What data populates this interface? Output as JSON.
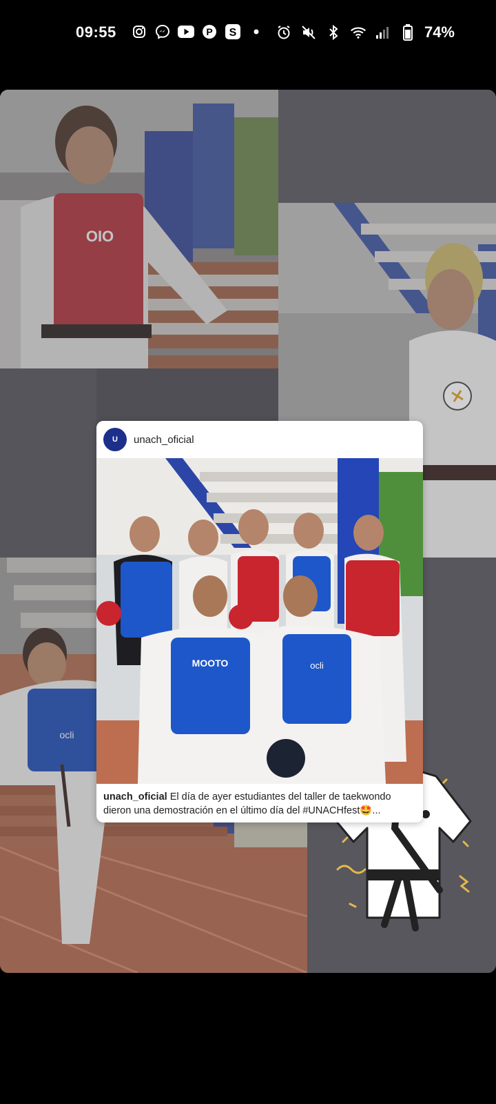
{
  "status_bar": {
    "time": "09:55",
    "left_icons": [
      "instagram-icon",
      "messenger-icon",
      "youtube-icon",
      "pinterest-icon",
      "skype-icon",
      "dot-icon"
    ],
    "right_icons": [
      "alarm-icon",
      "mute-icon",
      "bluetooth-icon",
      "wifi-icon",
      "signal-icon",
      "battery-icon"
    ],
    "battery_percent": "74%"
  },
  "post": {
    "username": "unach_oficial",
    "avatar_text": "U",
    "caption_user": "unach_oficial",
    "caption_text": "El día de ayer estudiantes del taller de taekwondo dieron una demostración en el último día del #UNACHfest🤩..."
  },
  "sticker": {
    "icon": "taekwondo-uniform-icon"
  },
  "colors": {
    "background": "#000000",
    "story_grey": "#56565c",
    "post_card": "#ffffff",
    "accent_blue": "#1c2f8a",
    "vest_red": "#c9252f",
    "vest_blue": "#1e57c9"
  }
}
